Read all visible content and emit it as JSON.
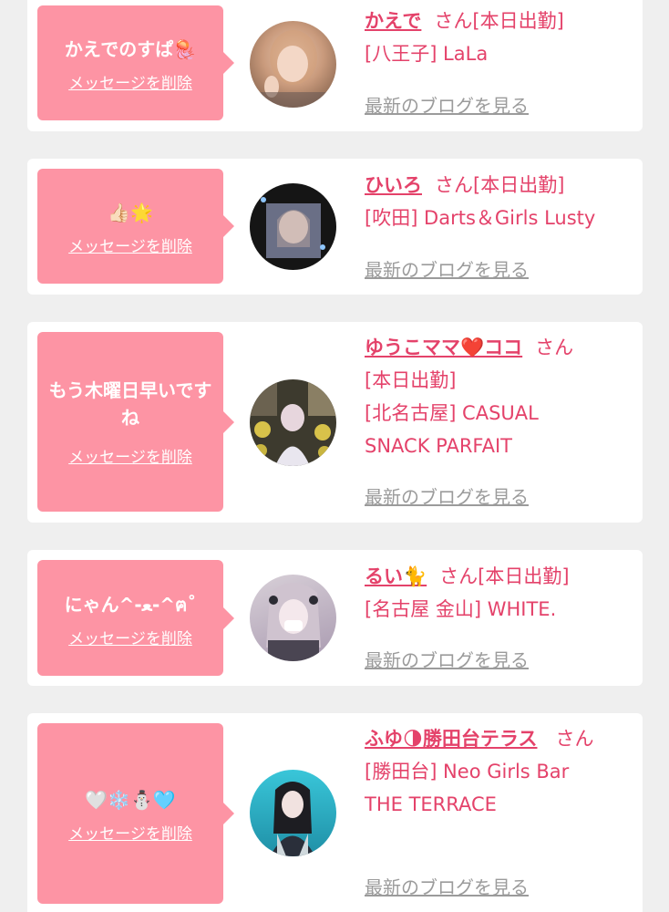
{
  "delete_label": "メッセージを削除",
  "blog_label": "最新のブログを見る",
  "san_label": "さん",
  "colors": {
    "bubble": "#fd94a4",
    "accent": "#e4426a",
    "muted": "#9b9b9b",
    "background": "#efefef"
  },
  "cards": [
    {
      "message": "かえでのすぱ🪼",
      "name": "かえで",
      "status": "[本日出勤]",
      "shop": "[八王子] LaLa"
    },
    {
      "message": "👍🏻🌟",
      "name": "ひいろ",
      "status": "[本日出勤]",
      "shop": "[吹田] Darts＆Girls Lusty"
    },
    {
      "message": "もう木曜日早いですね",
      "name": "ゆうこママ❤️ココ",
      "status": "[本日出勤]",
      "shop": "[北名古屋] CASUAL SNACK PARFAIT"
    },
    {
      "message": "にゃん^-ﻌ-^ฅ˚",
      "name": "るい🐈",
      "status": "[本日出勤]",
      "shop": "[名古屋 金山] WHITE."
    },
    {
      "message": "🤍❄️⛄️🩵",
      "name": "ふゆ🌗勝田台テラス",
      "status": "",
      "shop": "[勝田台] Neo Girls Bar THE TERRACE"
    }
  ]
}
